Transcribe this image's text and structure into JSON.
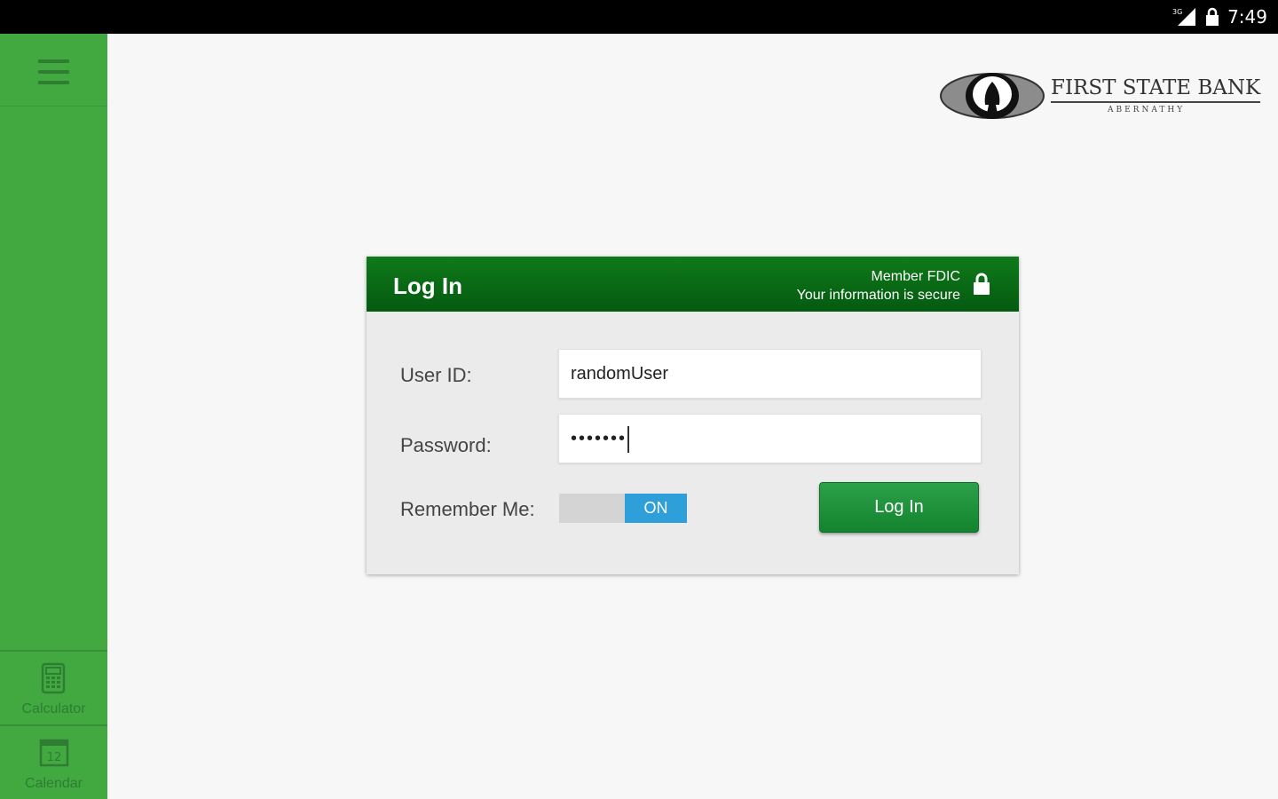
{
  "status_bar": {
    "time": "7:49",
    "network": "3G"
  },
  "sidebar": {
    "items": [
      {
        "label": "Calculator",
        "icon": "calculator-icon"
      },
      {
        "label": "Calendar",
        "icon": "calendar-icon",
        "icon_text": "12"
      }
    ]
  },
  "logo": {
    "name": "FIRST STATE BANK",
    "subtitle": "ABERNATHY"
  },
  "login": {
    "title": "Log In",
    "fdic_line1": "Member FDIC",
    "fdic_line2": "Your information is secure",
    "user_id_label": "User ID:",
    "user_id_value": "randomUser",
    "password_label": "Password:",
    "password_value": "•••••••",
    "remember_label": "Remember Me:",
    "remember_state": "ON",
    "button_label": "Log In"
  },
  "colors": {
    "sidebar": "#41a940",
    "header": "#0a6b16",
    "button": "#1f913c",
    "toggle_on": "#2f9fd9"
  }
}
